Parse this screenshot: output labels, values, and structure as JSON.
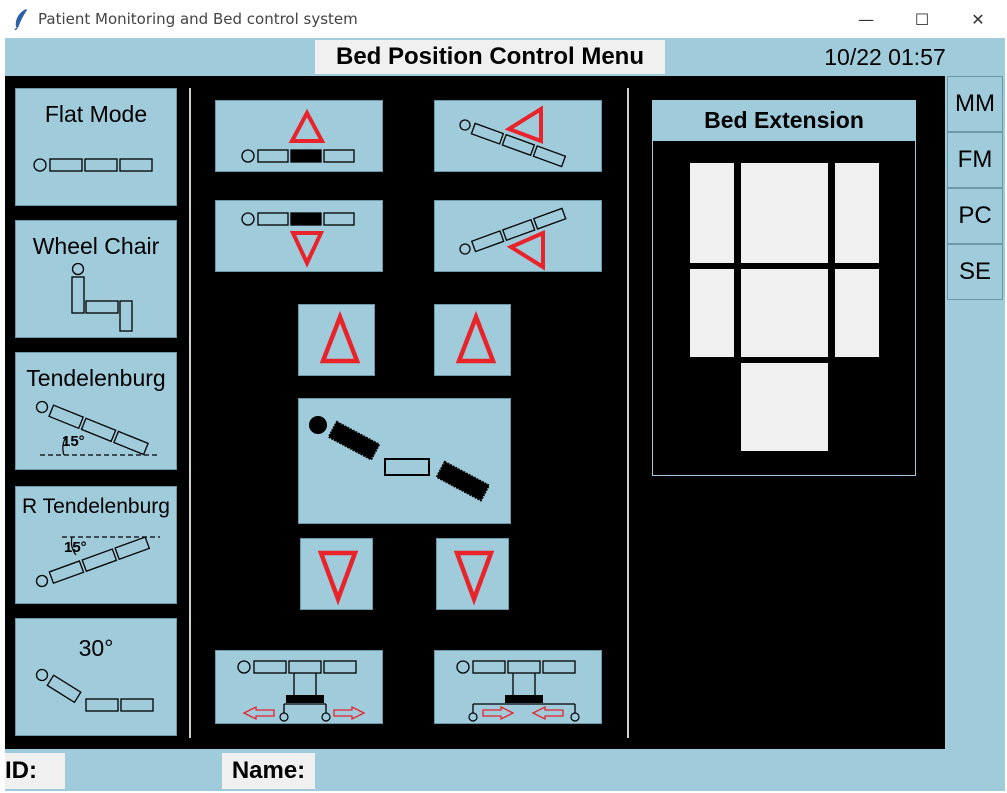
{
  "window": {
    "title": "Patient Monitoring and Bed control system",
    "minimize_glyph": "—",
    "maximize_glyph": "☐",
    "close_glyph": "✕",
    "app_icon": "feather-icon"
  },
  "header": {
    "menu_title": "Bed Position Control Menu",
    "datetime": "10/22 01:57"
  },
  "modes": [
    {
      "label": "Flat Mode",
      "icon": "flat-bed-icon"
    },
    {
      "label": "Wheel Chair",
      "icon": "wheelchair-position-icon"
    },
    {
      "label": "Tendelenburg",
      "icon": "trendelenburg-icon",
      "angle": "15°"
    },
    {
      "label": "R Tendelenburg",
      "icon": "reverse-trendelenburg-icon",
      "angle": "15°"
    },
    {
      "label": "30°",
      "icon": "incline-30-icon"
    }
  ],
  "right_tabs": [
    "MM",
    "FM",
    "PC",
    "SE"
  ],
  "extension": {
    "title": "Bed Extension"
  },
  "footer": {
    "id_label": "ID:",
    "id_value": "",
    "name_label": "Name:",
    "name_value": ""
  },
  "colors": {
    "panel": "#9fcbdb",
    "arrow_red": "#e8232a",
    "background": "#000000"
  }
}
